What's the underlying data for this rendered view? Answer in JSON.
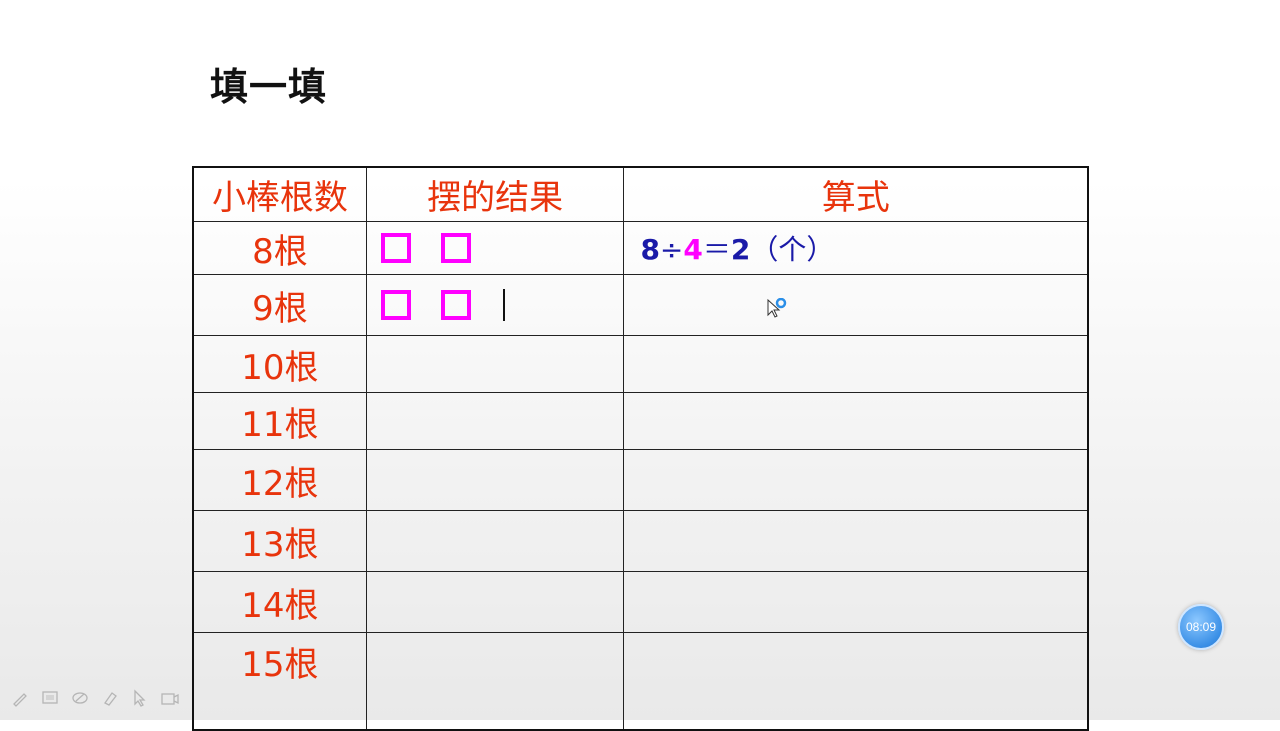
{
  "title": "填一填",
  "table": {
    "headers": [
      "小棒根数",
      "摆的结果",
      "算式"
    ],
    "rows": [
      {
        "count": "8根",
        "squares": 2,
        "expression": {
          "a": "8",
          "op": "÷",
          "b": "4",
          "eq": "＝",
          "result": "2",
          "unit": "（个）"
        }
      },
      {
        "count": "9根",
        "squares": 2,
        "expression": null
      },
      {
        "count": "10根",
        "squares": 0,
        "expression": null
      },
      {
        "count": "11根",
        "squares": 0,
        "expression": null
      },
      {
        "count": "12根",
        "squares": 0,
        "expression": null
      },
      {
        "count": "13根",
        "squares": 0,
        "expression": null
      },
      {
        "count": "14根",
        "squares": 0,
        "expression": null
      },
      {
        "count": "15根",
        "squares": 0,
        "expression": null
      }
    ]
  },
  "timer": "08:09",
  "colors": {
    "header_text": "#e8340c",
    "square_border": "#ff00ff",
    "expression_text": "#1a1aa8"
  },
  "toolbar_icons": [
    "pen-icon",
    "screen-icon",
    "eraser-icon",
    "highlighter-icon",
    "pointer-icon",
    "camera-icon"
  ]
}
